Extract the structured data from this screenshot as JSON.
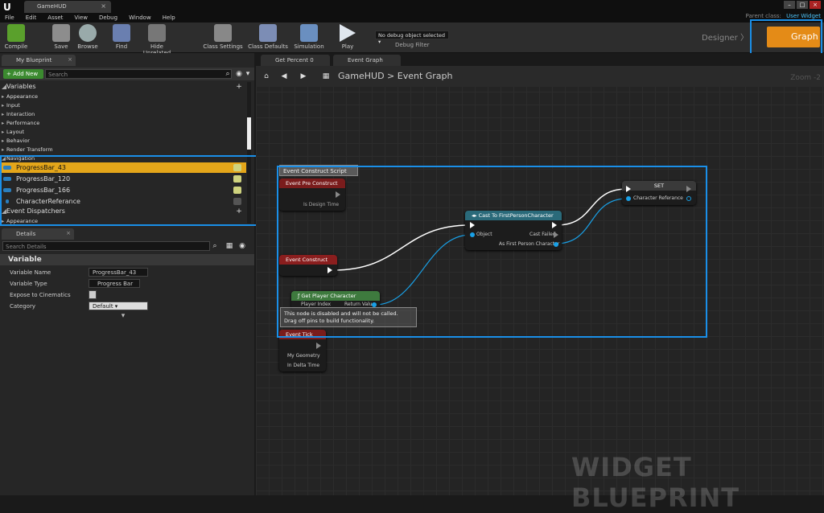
{
  "title_bar": {
    "logo": "U",
    "doc_tab": "GameHUD",
    "tab_close": "×"
  },
  "menu": [
    "File",
    "Edit",
    "Asset",
    "View",
    "Debug",
    "Window",
    "Help"
  ],
  "menubar_right": {
    "parent_class": "Parent class:",
    "class_name": "User Widget"
  },
  "toolbar": {
    "items": [
      "Compile",
      "Save",
      "Browse",
      "Find",
      "Hide Unrelated",
      "Class Settings",
      "Class Defaults",
      "Simulation",
      "Play"
    ],
    "debug_select": "No debug object selected",
    "debug_filter": "Debug Filter"
  },
  "modes": {
    "designer": "Designer",
    "graph": "Graph"
  },
  "my_blueprint": {
    "tab": "My Blueprint",
    "add_new": "+ Add New",
    "search_placeholder": "Search",
    "variables_header": "Variables",
    "categories": [
      "Appearance",
      "Input",
      "Interaction",
      "Performance",
      "Layout",
      "Behavior",
      "Render Transform",
      "Navigation"
    ],
    "variables": [
      "ProgressBar_43",
      "ProgressBar_120",
      "ProgressBar_166",
      "CharacterReferance"
    ],
    "event_dispatchers": "Event Dispatchers",
    "dispatcher_cat": "Appearance"
  },
  "details": {
    "tab": "Details",
    "search_placeholder": "Search Details",
    "section": "Variable",
    "rows": [
      {
        "label": "Variable Name",
        "value": "ProgressBar_43"
      },
      {
        "label": "Variable Type",
        "value": "Progress Bar"
      },
      {
        "label": "Expose to Cinematics",
        "value": ""
      },
      {
        "label": "Category",
        "value": "Default"
      }
    ]
  },
  "graph": {
    "tabs": [
      "Get Percent 0",
      "Event Graph"
    ],
    "breadcrumb": "GameHUD  >  Event Graph",
    "zoom": "Zoom -2",
    "watermark": "WIDGET BLUEPRINT",
    "comment": "Event Construct Script",
    "nodes": {
      "pre_construct": "Event Pre Construct",
      "is_design_time": "Is Design Time",
      "construct": "Event Construct",
      "get_player": "Get Player Character",
      "player_index": "Player Index",
      "return_value": "Return Value",
      "disabled_note": "This node is disabled and will not be called.\nDrag off pins to build functionality.",
      "tick": "Event Tick",
      "my_geometry": "My Geometry",
      "in_delta": "In Delta Time",
      "cast": "Cast To FirstPersonCharacter",
      "object": "Object",
      "cast_failed": "Cast Failed",
      "as_fpc": "As First Person Character",
      "set": "SET",
      "char_ref": "Character Referance"
    }
  },
  "colors": {
    "accent": "#e48b17",
    "selection": "#e4a61a",
    "highlight": "#1a8fe8",
    "pin": "#19a0e6"
  }
}
